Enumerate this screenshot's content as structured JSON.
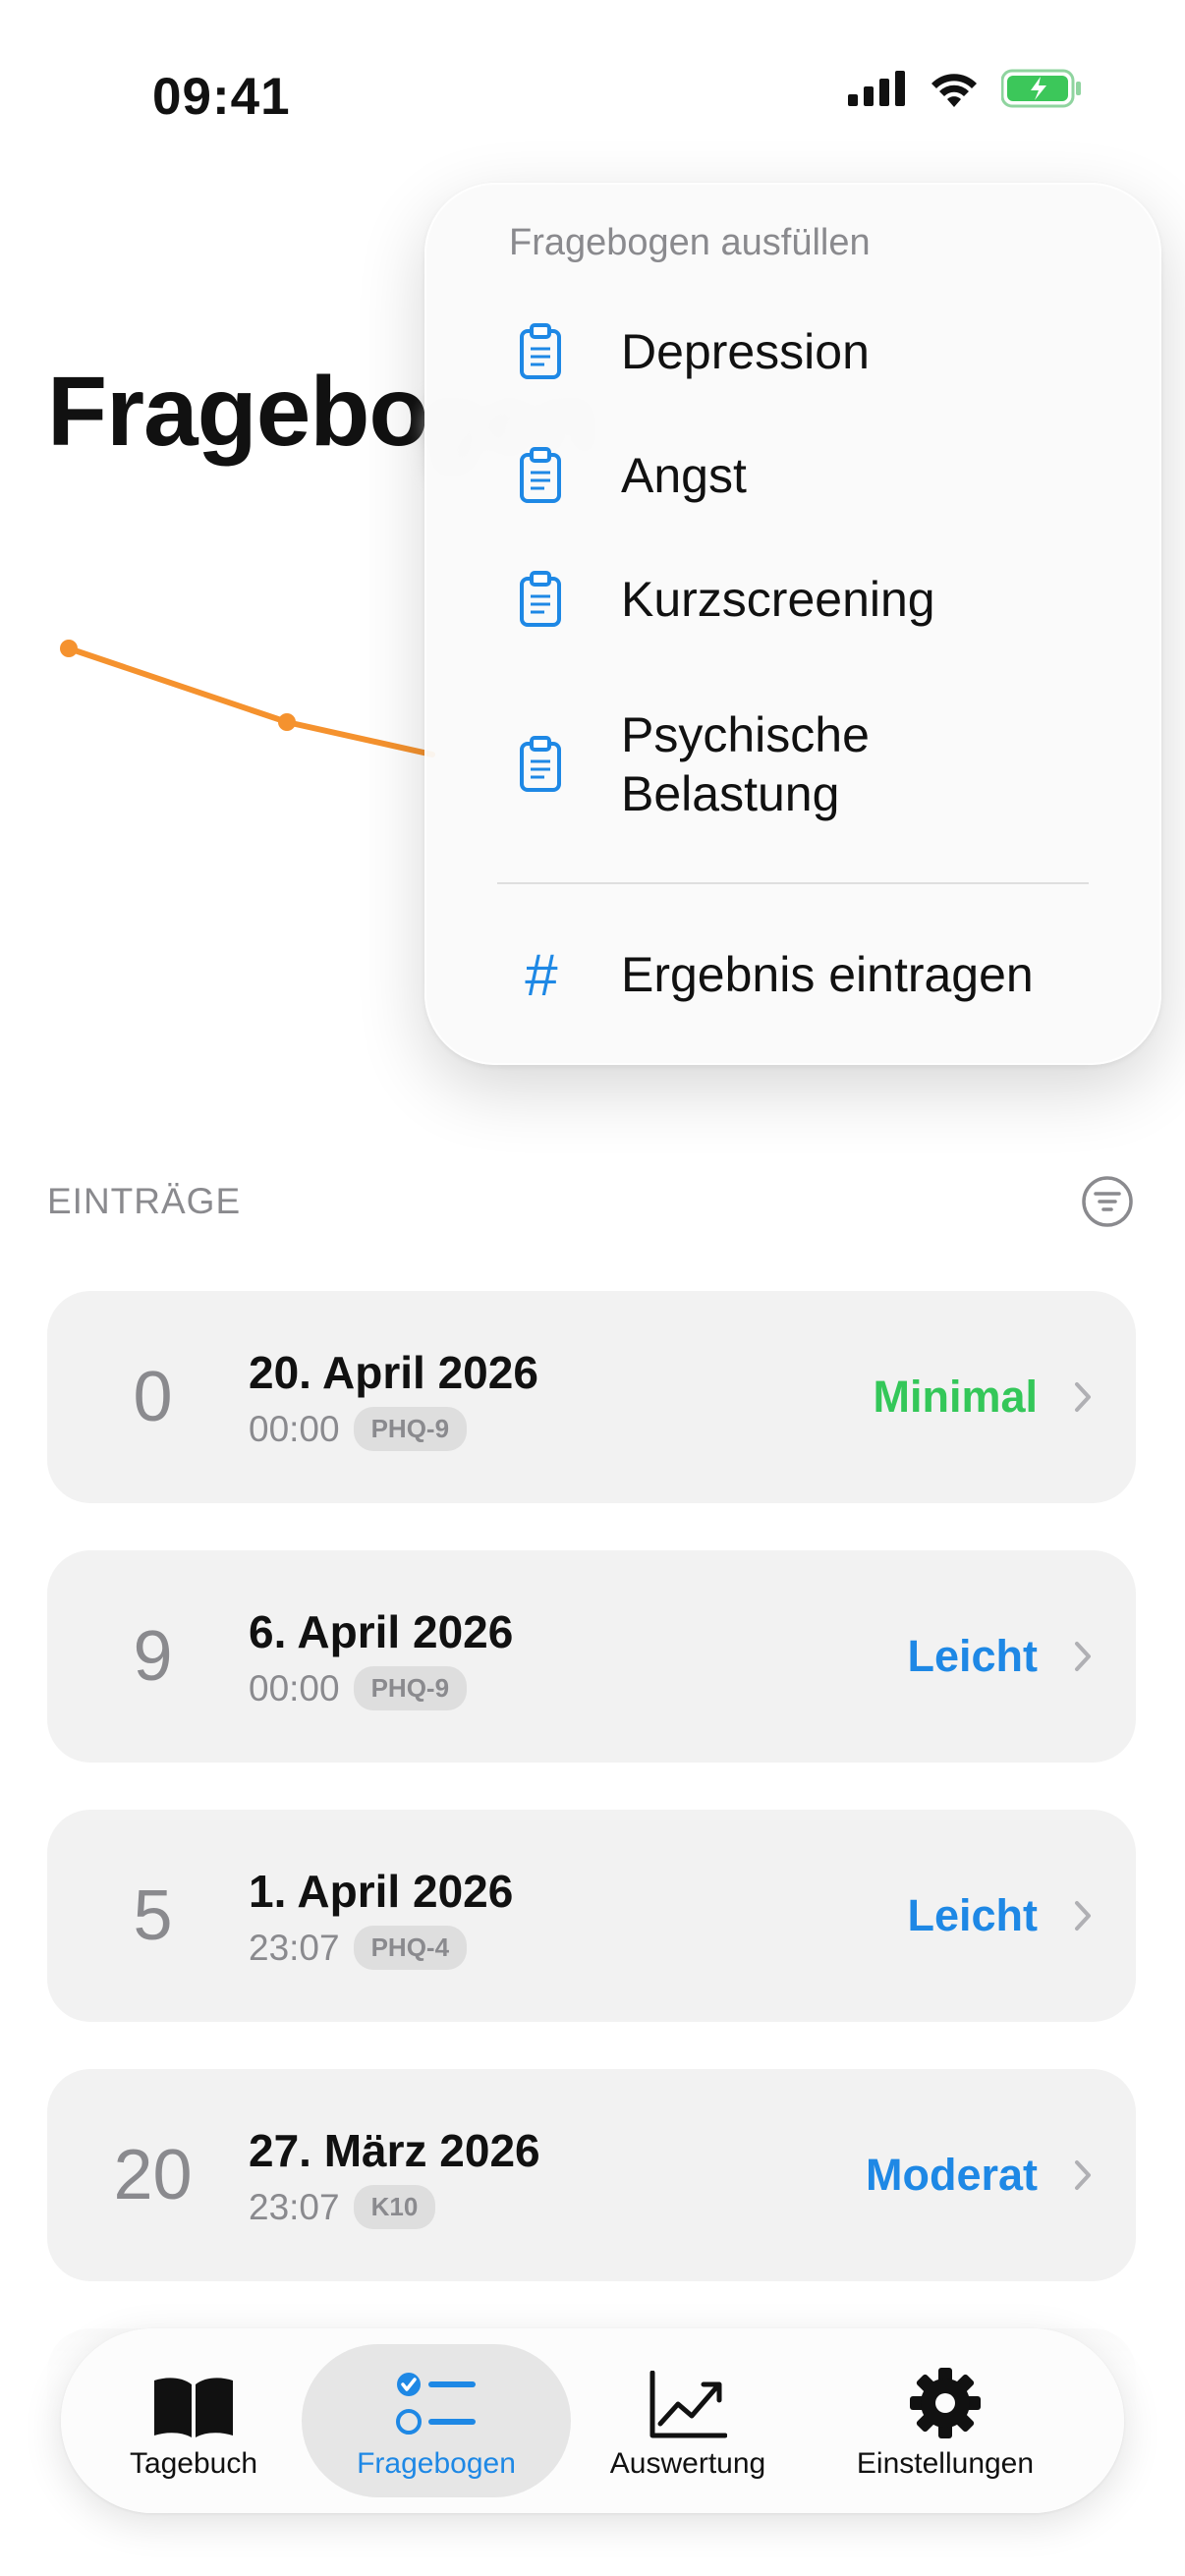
{
  "status_bar": {
    "time": "09:41"
  },
  "page": {
    "title": "Fragebogen",
    "title_visible_part": "Fragebo"
  },
  "menu": {
    "header": "Fragebogen ausfüllen",
    "items": [
      {
        "label": "Depression",
        "icon": "clipboard-icon"
      },
      {
        "label": "Angst",
        "icon": "clipboard-icon"
      },
      {
        "label": "Kurzscreening",
        "icon": "clipboard-icon"
      },
      {
        "label_line1": "Psychische",
        "label_line2": "Belastung",
        "icon": "clipboard-icon"
      }
    ],
    "action": {
      "label": "Ergebnis eintragen",
      "icon": "#"
    }
  },
  "entries_section": {
    "title": "EINTRÄGE"
  },
  "entries": [
    {
      "score": "0",
      "date": "20. April 2026",
      "time": "00:00",
      "badge": "PHQ-9",
      "severity": "Minimal",
      "severity_color": "#34c759"
    },
    {
      "score": "9",
      "date": "6. April 2026",
      "time": "00:00",
      "badge": "PHQ-9",
      "severity": "Leicht",
      "severity_color": "#1e88e5"
    },
    {
      "score": "5",
      "date": "1. April 2026",
      "time": "23:07",
      "badge": "PHQ-4",
      "severity": "Leicht",
      "severity_color": "#1e88e5"
    },
    {
      "score": "20",
      "date": "27. März 2026",
      "time": "23:07",
      "badge": "K10",
      "severity": "Moderat",
      "severity_color": "#1e88e5"
    }
  ],
  "tabbar": {
    "tabs": [
      {
        "label": "Tagebuch",
        "icon": "book-icon",
        "active": false
      },
      {
        "label": "Fragebogen",
        "icon": "checklist-icon",
        "active": true
      },
      {
        "label": "Auswertung",
        "icon": "chart-line-icon",
        "active": false
      },
      {
        "label": "Einstellungen",
        "icon": "gear-icon",
        "active": false
      }
    ]
  },
  "colors": {
    "accent": "#1e88e5",
    "chart_line": "#f5922e",
    "minimal": "#34c759"
  }
}
